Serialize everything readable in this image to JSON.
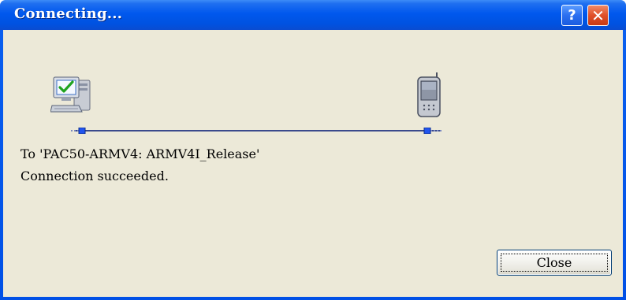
{
  "window": {
    "title": "Connecting...",
    "help_button": "?",
    "close_button": "✕"
  },
  "connection": {
    "source_icon": "computer-icon",
    "target_icon": "handheld-device-icon"
  },
  "message": {
    "line1": "To 'PAC50-ARMV4: ARMV4I_Release'",
    "line2": "Connection succeeded."
  },
  "buttons": {
    "close_label": "Close"
  },
  "colors": {
    "titlebar": "#0058ee",
    "client_bg": "#ece9d8",
    "close_x_bg": "#e0502a"
  }
}
